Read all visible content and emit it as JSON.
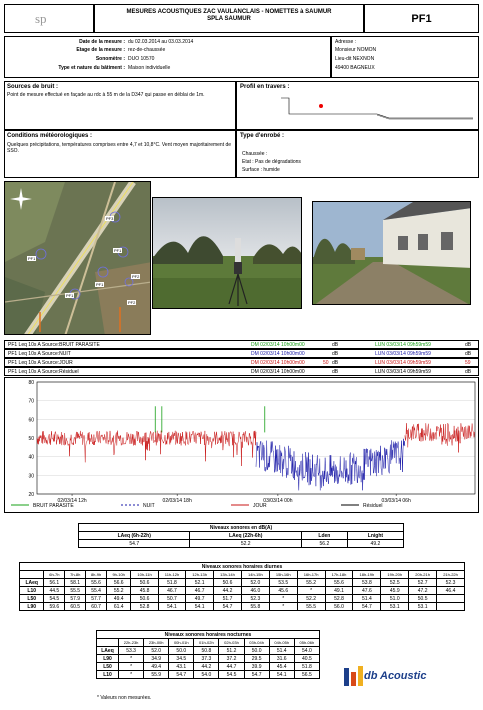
{
  "header": {
    "logo_text": "sp",
    "title_line1": "MESURES ACOUSTIQUES ZAC VAULANCLAIS - NOMETTES à SAUMUR",
    "title_line2": "SPLA SAUMUR",
    "point_id": "PF1"
  },
  "meta": {
    "date_label": "Date de la mesure :",
    "date_value": "du 02.03.2014 au 03.03.2014",
    "floor_label": "Etage de la mesure :",
    "floor_value": "rez-de-chaussée",
    "sonometer_label": "Sonomètre :",
    "sonometer_value": "DUO 10570",
    "building_label": "Type et nature du bâtiment :",
    "building_value": "Maison individuelle",
    "address_label": "Adresse :",
    "address_line1": "Monsieur NOMON",
    "address_line2": "Lieu-dit NEXNON",
    "address_line3": "49400 BAGNEUX"
  },
  "sources": {
    "label": "Sources de bruit :",
    "text": "Point de mesure effectué en façade au rdc à 55 m de la D347 qui passe en déblai de 1m."
  },
  "profile": {
    "label": "Profil en travers :"
  },
  "meteo": {
    "label": "Conditions météorologiques :",
    "text": "Quelques précipitations, températures comprises entre 4,7 et 10,8°C. Vent moyen majoritairement de SSO."
  },
  "surface": {
    "label": "Type d'enrobé :",
    "chaussee_label": "Chaussée :",
    "etat": "Etat : Pas de dégradations",
    "surface": "Surface : humide"
  },
  "map": {
    "markers": [
      "PF3",
      "PF1",
      "PF1",
      "PF1",
      "PF1",
      "PF2",
      "PF2"
    ]
  },
  "sources_table": [
    {
      "left": "PF1   Leq 10s A  Source:BRUIT PARASITE",
      "mid": "DM 02/03/14 10h00m00",
      "num": "",
      "unit": "dB",
      "right": "LUN 03/03/14 09h59m59",
      "unit2": "dB",
      "color": "#17a017"
    },
    {
      "left": "PF1   Leq 10s A  Source:NUIT",
      "mid": "DM 02/03/14 10h00m00",
      "num": "",
      "unit": "dB",
      "right": "LUN 03/03/14 09h59m59",
      "unit2": "dB",
      "color": "#1a1aa8"
    },
    {
      "left": "PF1   Leq 10s A  Source:JOUR",
      "mid": "DM 02/03/14 10h00m00",
      "num": "50",
      "unit": "dB",
      "right": "LUN 03/03/14 09h59m59",
      "unit2": "59",
      "color": "#c81414"
    },
    {
      "left": "PF1   Leq 10s A  Source:Résiduel",
      "mid": "DM 02/03/14 10h00m00",
      "num": "",
      "unit": "dB",
      "right": "LUN 03/03/14 09h59m59",
      "unit2": "dB",
      "color": "#000000"
    }
  ],
  "chart_data": {
    "type": "line",
    "y_ticks": [
      "80",
      "70",
      "60",
      "50",
      "40",
      "30",
      "20"
    ],
    "ylim": [
      20,
      80
    ],
    "x_ticks": [
      "02/03/14 12h",
      "02/03/14 18h",
      "03/03/14 00h",
      "03/03/14 06h"
    ],
    "legend": [
      {
        "name": "BRUIT PARASITE",
        "color": "#17a017"
      },
      {
        "name": "NUIT",
        "color": "#1a1aa8"
      },
      {
        "name": "JOUR",
        "color": "#c81414"
      },
      {
        "name": "Résiduel",
        "color": "#000000"
      }
    ],
    "series": [
      {
        "name": "JOUR",
        "color": "#c81414",
        "level_db": 50
      },
      {
        "name": "NUIT",
        "color": "#1a1aa8",
        "level_db": 42
      },
      {
        "name": "JOUR",
        "color": "#c81414",
        "level_db": 53
      }
    ]
  },
  "levels": {
    "title": "Niveaux sonores en dB(A)",
    "headers": [
      "LAeq (6h-22h)",
      "LAeq (22h-6h)",
      "Lden",
      "Lnight"
    ],
    "values": [
      "54.7",
      "52.2",
      "56.2",
      "49.2"
    ]
  },
  "diurnal": {
    "title": "Niveaux sonores horaires diurnes",
    "headers": [
      "",
      "6h-7h",
      "7h-8h",
      "8h-9h",
      "9h-10h",
      "10h-11h",
      "11h-12h",
      "12h-13h",
      "13h-14h",
      "14h-15h",
      "15h-16h",
      "16h-17h",
      "17h-18h",
      "18h-19h",
      "19h-20h",
      "20h-21h",
      "21h-22h"
    ],
    "rows": [
      [
        "LAeq",
        "56.1",
        "58.1",
        "55.6",
        "56.6",
        "50.6",
        "51.8",
        "52.1",
        "50.6",
        "52.0",
        "53.5",
        "55.2",
        "55.6",
        "53.8",
        "52.5",
        "52.7",
        "52.3"
      ],
      [
        "L10",
        "44.5",
        "55.5",
        "55.4",
        "55.2",
        "45.8",
        "46.7",
        "46.7",
        "44.2",
        "46.0",
        "45.6",
        "*",
        "49.1",
        "47.6",
        "45.9",
        "47.2",
        "46.4"
      ],
      [
        "L50",
        "54.5",
        "57.9",
        "57.7",
        "49.4",
        "50.6",
        "50.7",
        "49.7",
        "51.7",
        "52.3",
        "*",
        "52.2",
        "52.8",
        "51.4",
        "51.0",
        "50.5",
        ""
      ],
      [
        "L90",
        "59.6",
        "60.5",
        "60.7",
        "61.4",
        "52.8",
        "54.1",
        "54.1",
        "54.7",
        "55.8",
        "*",
        "55.5",
        "56.0",
        "54.7",
        "53.1",
        "53.1",
        ""
      ]
    ]
  },
  "nocturnal": {
    "title": "Niveaux sonores horaires nocturnes",
    "headers": [
      "",
      "22h-23h",
      "23h-00h",
      "00h-01h",
      "01h-02h",
      "02h-03h",
      "03h-04h",
      "04h-05h",
      "05h-06h"
    ],
    "rows": [
      [
        "LAeq",
        "53.3",
        "52.0",
        "50.0",
        "50.8",
        "51.2",
        "50.0",
        "51.4",
        "54.0"
      ],
      [
        "L90",
        "*",
        "34.9",
        "34.5",
        "37.3",
        "37.2",
        "29.5",
        "31.6",
        "40.5"
      ],
      [
        "L50",
        "*",
        "49.4",
        "43.1",
        "44.2",
        "44.7",
        "39.9",
        "45.4",
        "51.8"
      ],
      [
        "L10",
        "*",
        "55.9",
        "54.7",
        "54.0",
        "54.5",
        "54.7",
        "54.1",
        "56.5"
      ]
    ],
    "footnote": "* Valeurs non mesurées."
  },
  "footer_logo": {
    "a": "db",
    "b": "Acoustic"
  }
}
